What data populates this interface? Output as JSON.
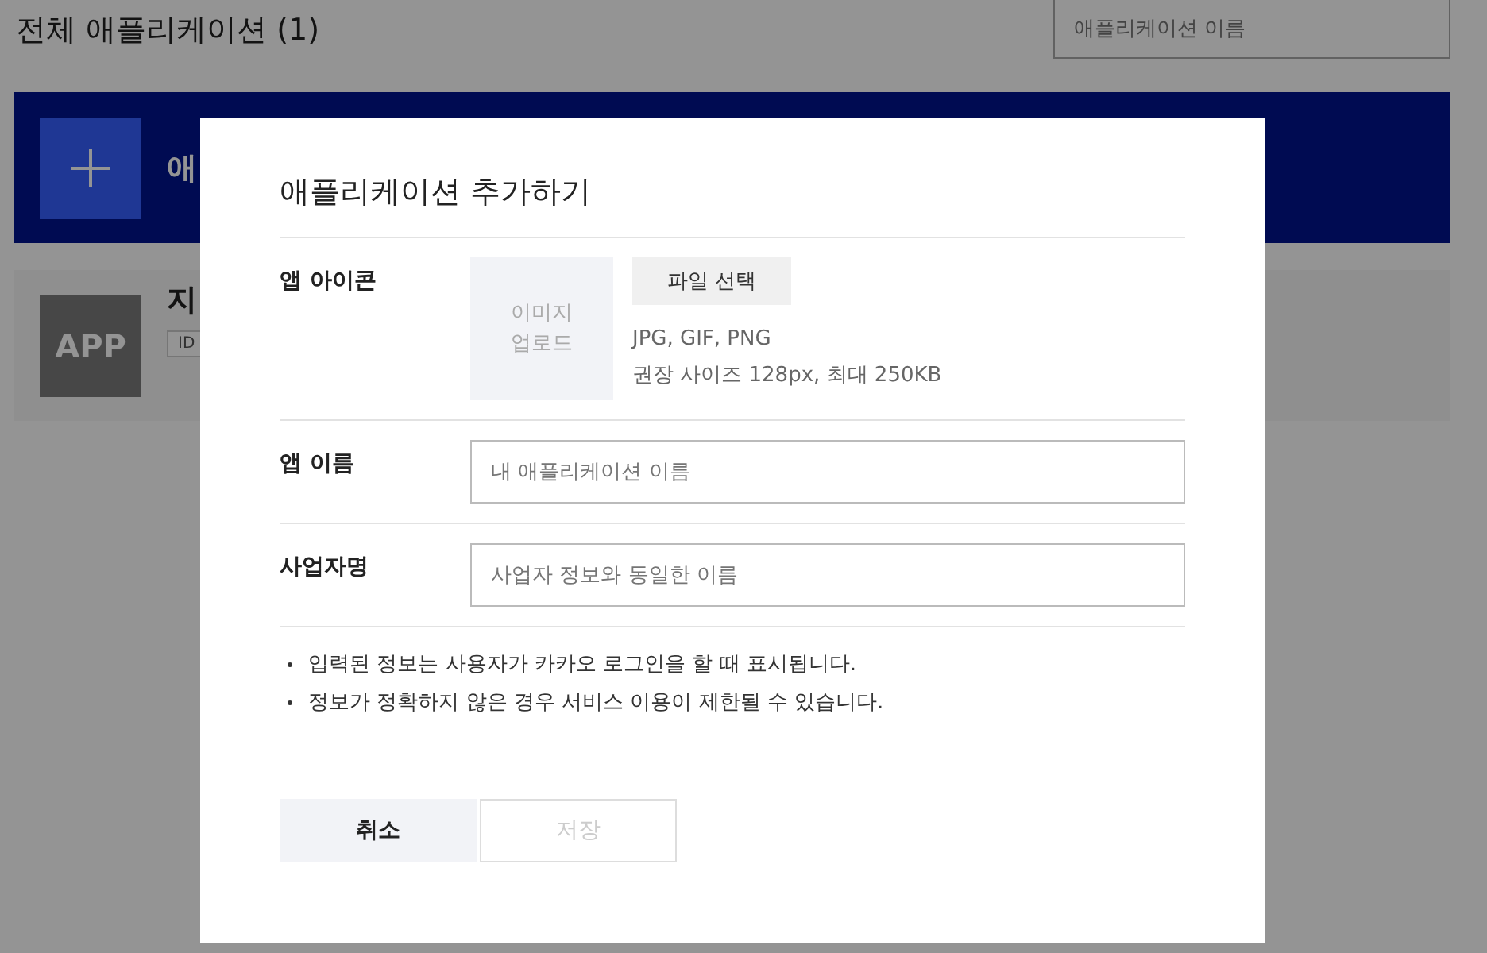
{
  "page": {
    "title": "전체 애플리케이션 (1)",
    "search": {
      "placeholder": "애플리케이션 이름"
    },
    "add_card": {
      "label": "애"
    },
    "app_card": {
      "icon_text": "APP",
      "name": "지",
      "id_tag": "ID"
    }
  },
  "dialog": {
    "title": "애플리케이션 추가하기",
    "rows": [
      {
        "kind": "icon",
        "label": "앱 아이콘",
        "upload_text": "이미지\n업로드",
        "button": "파일 선택",
        "hints": [
          "JPG, GIF, PNG",
          "권장 사이즈 128px, 최대 250KB"
        ]
      },
      {
        "kind": "input",
        "label": "앱 이름",
        "placeholder": "내 애플리케이션 이름"
      },
      {
        "kind": "input",
        "label": "사업자명",
        "placeholder": "사업자 정보와 동일한 이름"
      }
    ],
    "notes": [
      "입력된 정보는 사용자가 카카오 로그인을 할 때 표시됩니다.",
      "정보가 정확하지 않은 경우 서비스 이용이 제한될 수 있습니다."
    ],
    "buttons": [
      {
        "label": "취소",
        "disabled": false
      },
      {
        "label": "저장",
        "disabled": true
      }
    ]
  }
}
